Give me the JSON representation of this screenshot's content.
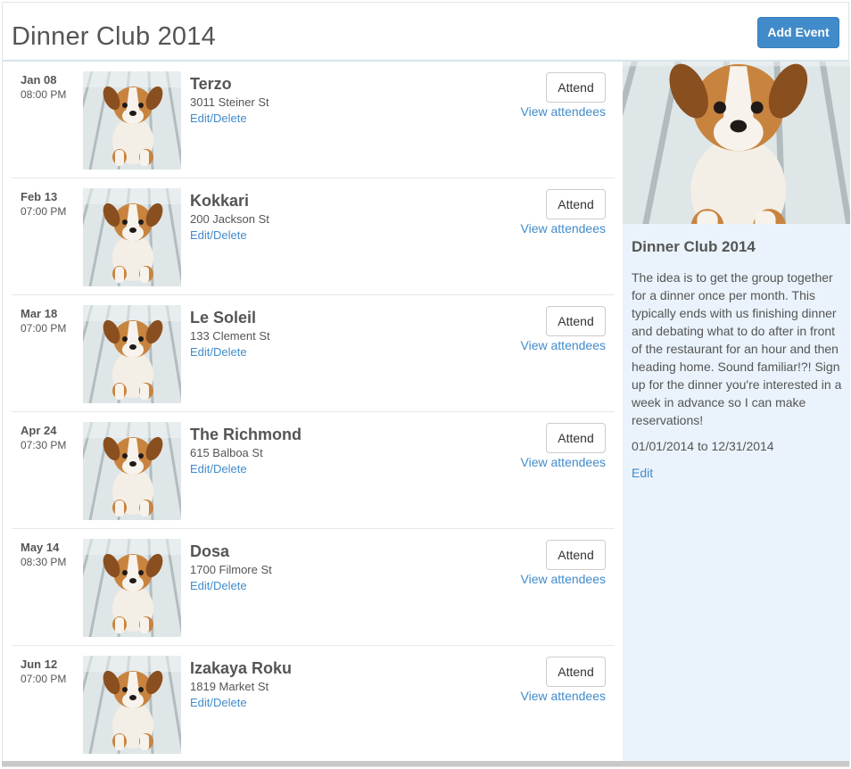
{
  "header": {
    "title": "Dinner Club 2014",
    "add_event_label": "Add Event"
  },
  "colors": {
    "accent": "#428bca",
    "sidebar_bg": "#eaf3fb",
    "text": "#555555"
  },
  "events": [
    {
      "date": "Jan 08",
      "time": "08:00 PM",
      "name": "Terzo",
      "address": "3011 Steiner St",
      "edit_label": "Edit/Delete",
      "attend_label": "Attend",
      "view_label": "View attendees",
      "image": "puppy-photo"
    },
    {
      "date": "Feb 13",
      "time": "07:00 PM",
      "name": "Kokkari",
      "address": "200 Jackson St",
      "edit_label": "Edit/Delete",
      "attend_label": "Attend",
      "view_label": "View attendees",
      "image": "puppy-photo"
    },
    {
      "date": "Mar 18",
      "time": "07:00 PM",
      "name": "Le Soleil",
      "address": "133 Clement St",
      "edit_label": "Edit/Delete",
      "attend_label": "Attend",
      "view_label": "View attendees",
      "image": "puppy-photo"
    },
    {
      "date": "Apr 24",
      "time": "07:30 PM",
      "name": "The Richmond",
      "address": "615 Balboa St",
      "edit_label": "Edit/Delete",
      "attend_label": "Attend",
      "view_label": "View attendees",
      "image": "puppy-photo"
    },
    {
      "date": "May 14",
      "time": "08:30 PM",
      "name": "Dosa",
      "address": "1700 Filmore St",
      "edit_label": "Edit/Delete",
      "attend_label": "Attend",
      "view_label": "View attendees",
      "image": "puppy-photo"
    },
    {
      "date": "Jun 12",
      "time": "07:00 PM",
      "name": "Izakaya Roku",
      "address": "1819 Market St",
      "edit_label": "Edit/Delete",
      "attend_label": "Attend",
      "view_label": "View attendees",
      "image": "puppy-photo"
    }
  ],
  "sidebar": {
    "image": "puppy-photo",
    "title": "Dinner Club 2014",
    "description": "The idea is to get the group together for a dinner once per month. This typically ends with us finishing dinner and debating what to do after in front of the restaurant for an hour and then heading home. Sound familiar!?! Sign up for the dinner you're interested in a week in advance so I can make reservations!",
    "date_range": "01/01/2014 to 12/31/2014",
    "edit_label": "Edit"
  }
}
